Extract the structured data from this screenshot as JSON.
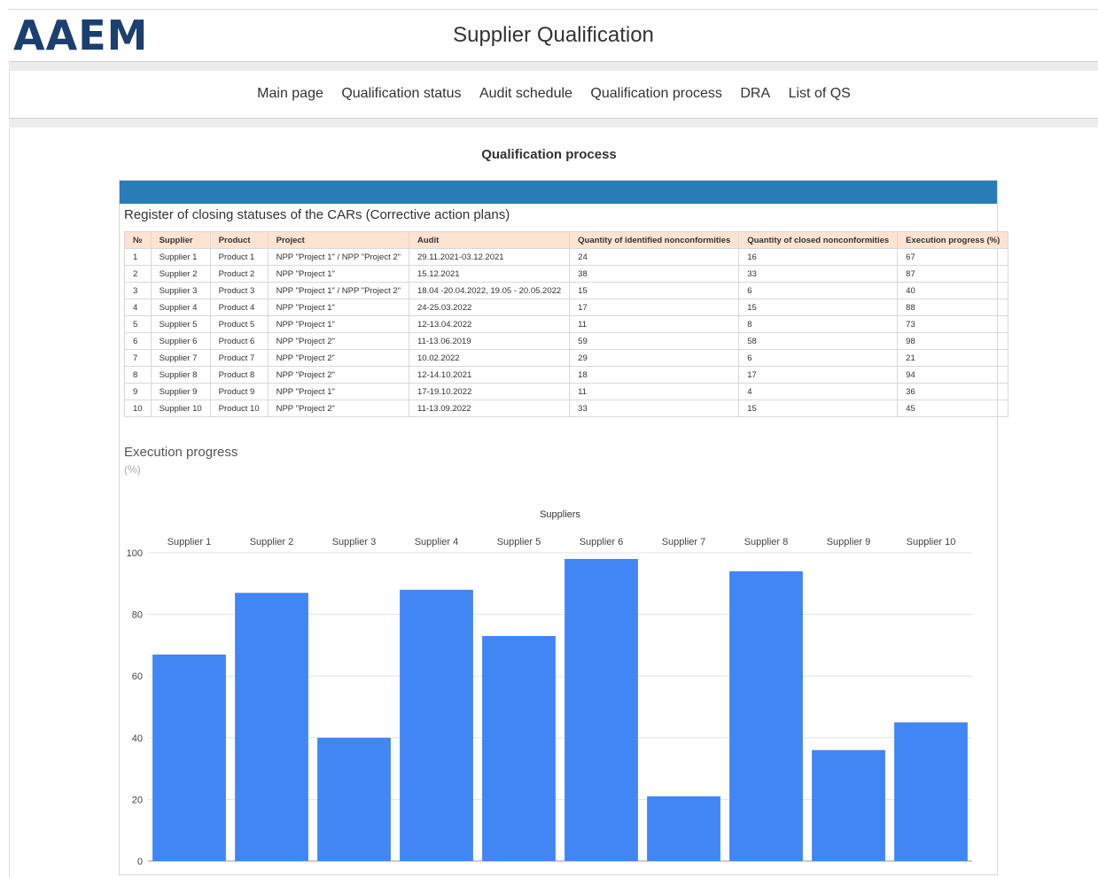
{
  "header": {
    "logo": "AAEM",
    "title": "Supplier Qualification"
  },
  "nav": {
    "items": [
      "Main page",
      "Qualification status",
      "Audit schedule",
      "Qualification process",
      "DRA",
      "List of QS"
    ]
  },
  "page": {
    "heading": "Qualification process"
  },
  "register": {
    "title": "Register of closing statuses of the CARs (Corrective action plans)",
    "columns": [
      "№",
      "Supplier",
      "Product",
      "Project",
      "Audit",
      "Quantity of identified nonconformities",
      "Quantity of closed nonconformities",
      "Execution progress (%)"
    ],
    "rows": [
      [
        "1",
        "Supplier 1",
        "Product 1",
        "NPP \"Project 1\" / NPP \"Project 2\"",
        "29.11.2021-03.12.2021",
        "24",
        "16",
        "67"
      ],
      [
        "2",
        "Supplier 2",
        "Product 2",
        "NPP \"Project 1\"",
        "15.12.2021",
        "38",
        "33",
        "87"
      ],
      [
        "3",
        "Supplier 3",
        "Product 3",
        "NPP \"Project 1\" / NPP \"Project 2\"",
        "18.04 -20.04.2022, 19.05 - 20.05.2022",
        "15",
        "6",
        "40"
      ],
      [
        "4",
        "Supplier 4",
        "Product 4",
        "NPP \"Project 1\"",
        "24-25.03.2022",
        "17",
        "15",
        "88"
      ],
      [
        "5",
        "Supplier 5",
        "Product 5",
        "NPP \"Project 1\"",
        "12-13.04.2022",
        "11",
        "8",
        "73"
      ],
      [
        "6",
        "Supplier 6",
        "Product 6",
        "NPP \"Project 2\"",
        "11-13.06.2019",
        "59",
        "58",
        "98"
      ],
      [
        "7",
        "Supplier 7",
        "Product 7",
        "NPP \"Project 2\"",
        "10.02.2022",
        "29",
        "6",
        "21"
      ],
      [
        "8",
        "Supplier 8",
        "Product 8",
        "NPP \"Project 2\"",
        "12-14.10.2021",
        "18",
        "17",
        "94"
      ],
      [
        "9",
        "Supplier 9",
        "Product 9",
        "NPP \"Project 1\"",
        "17-19.10.2022",
        "11",
        "4",
        "36"
      ],
      [
        "10",
        "Supplier 10",
        "Product 10",
        "NPP \"Project 2\"",
        "11-13.09.2022",
        "33",
        "15",
        "45"
      ]
    ]
  },
  "colors": {
    "bar": "#4285f4",
    "panel_bar": "#2a7cb6",
    "table_header": "#fde3d2",
    "logo": "#1c3f6e"
  },
  "chart_data": {
    "type": "bar",
    "title": "Execution progress",
    "subtitle": "(%)",
    "xlabel": "Suppliers",
    "x_axis_position": "top",
    "categories": [
      "Supplier 1",
      "Supplier 2",
      "Supplier 3",
      "Supplier 4",
      "Supplier 5",
      "Supplier 6",
      "Supplier 7",
      "Supplier 8",
      "Supplier 9",
      "Supplier 10"
    ],
    "values": [
      67,
      87,
      40,
      88,
      73,
      98,
      21,
      94,
      36,
      45
    ],
    "ylim": [
      0,
      100
    ],
    "yticks": [
      0,
      20,
      40,
      60,
      80,
      100
    ],
    "grid": true,
    "legend": false
  }
}
